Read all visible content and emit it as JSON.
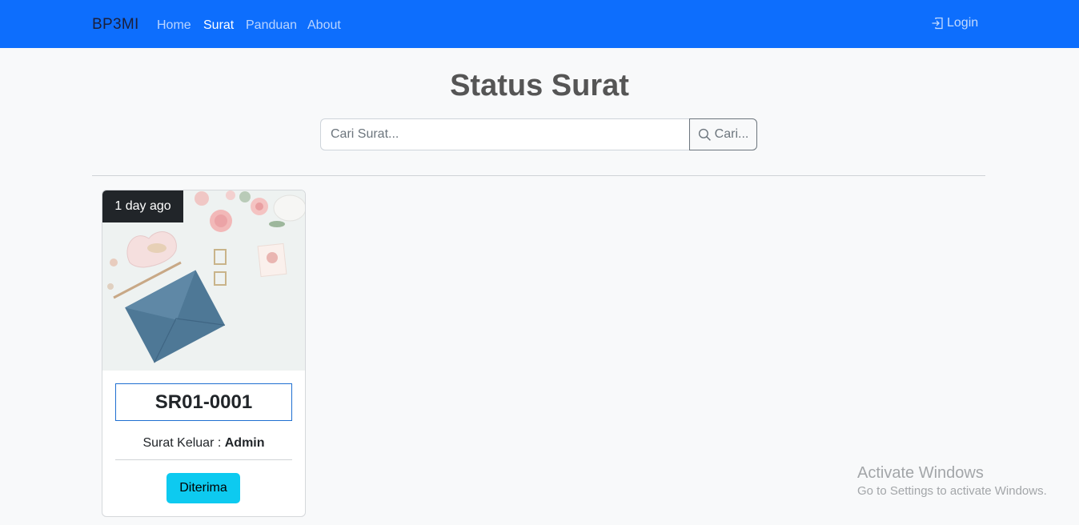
{
  "navbar": {
    "brand": "BP3MI",
    "links": [
      "Home",
      "Surat",
      "Panduan",
      "About"
    ],
    "active_link": "Surat",
    "login_label": "Login",
    "bg_color": "#0d6efd"
  },
  "main": {
    "title": "Status Surat",
    "search": {
      "placeholder": "Cari Surat...",
      "value": "",
      "button_label": "Cari..."
    }
  },
  "cards": [
    {
      "time_badge": "1 day ago",
      "code": "SR01-0001",
      "meta_label": "Surat Keluar :",
      "meta_value": "Admin",
      "status_label": "Diterima",
      "status_color": "#0dcaf0",
      "image": "envelope-flowers-photo"
    }
  ],
  "watermark": {
    "title": "Activate Windows",
    "subtitle": "Go to Settings to activate Windows."
  }
}
